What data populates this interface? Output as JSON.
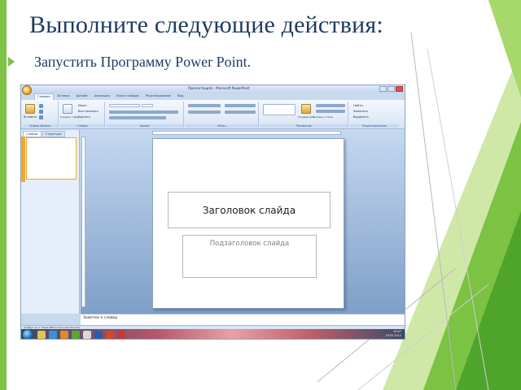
{
  "slide": {
    "title": "Выполните следующие действия:",
    "body": "Запустить Программу Power Point."
  },
  "colors": {
    "title_text": "#1f3b63",
    "accent_green": "#7cc243",
    "office_blue": "#c9d9ee",
    "slide_area": "#8fb0d8"
  },
  "screenshot": {
    "window_title": "Презентация1 - Microsoft PowerPoint",
    "tabs": [
      "Главная",
      "Вставка",
      "Дизайн",
      "Анимация",
      "Показ слайдов",
      "Рецензирование",
      "Вид"
    ],
    "ribbon_groups": [
      "Буфер обмена",
      "Слайды",
      "Шрифт",
      "Абзац",
      "Рисование",
      "Редактирование"
    ],
    "ribbon_buttons": {
      "paste": "Вставить",
      "new_slide": "Создать слайд",
      "layout": "Макет",
      "reset": "Восстановить",
      "delete": "Удалить",
      "arrange": "Упорядочить",
      "quick_styles": "Экспресс-стили",
      "find": "Найти",
      "replace": "Заменить",
      "select": "Выделить"
    },
    "left_pane_tabs": [
      "Слайды",
      "Структура"
    ],
    "placeholder_title": "Заголовок слайда",
    "placeholder_subtitle": "Подзаголовок слайда",
    "notes_placeholder": "Заметки к слайду",
    "status_text": "Слайд 1 из 1   \"Тема Office\"   Русский (Россия)",
    "clock_time": "20:07",
    "clock_date": "20.02.2012"
  }
}
